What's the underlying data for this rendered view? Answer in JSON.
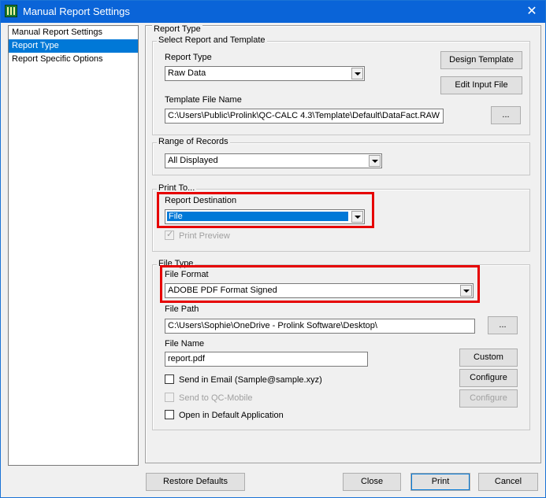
{
  "window": {
    "title": "Manual Report Settings"
  },
  "nav": {
    "items": [
      "Manual Report Settings",
      "Report Type",
      "Report Specific Options"
    ]
  },
  "report_type": {
    "group_label": "Report Type",
    "select_group_label": "Select Report and Template",
    "type_label": "Report Type",
    "type_value": "Raw Data",
    "design_template_button": "Design Template",
    "edit_input_file_button": "Edit Input File",
    "template_file_label": "Template File Name",
    "template_file_value": "C:\\Users\\Public\\Prolink\\QC-CALC 4.3\\Template\\Default\\DataFact.RAW",
    "browse_button": "..."
  },
  "range": {
    "group_label": "Range of Records",
    "value": "All Displayed"
  },
  "print_to": {
    "group_label": "Print To...",
    "destination_label": "Report Destination",
    "destination_value": "File",
    "print_preview_label": "Print Preview"
  },
  "file_type": {
    "group_label": "File Type",
    "format_label": "File Format",
    "format_value": "ADOBE PDF Format Signed",
    "path_label": "File Path",
    "path_value": "C:\\Users\\Sophie\\OneDrive - Prolink Software\\Desktop\\",
    "path_browse_button": "...",
    "name_label": "File Name",
    "name_value": "report.pdf",
    "custom_button": "Custom",
    "send_email_label": "Send in Email (Sample@sample.xyz)",
    "configure_button": "Configure",
    "send_mobile_label": "Send to QC-Mobile",
    "configure_mobile_button": "Configure",
    "open_default_label": "Open in Default Application"
  },
  "footer": {
    "restore_defaults": "Restore Defaults",
    "close": "Close",
    "print": "Print",
    "cancel": "Cancel"
  },
  "colors": {
    "title_bar": "#0a64d8",
    "selection": "#0078d7",
    "highlight_box": "#e60000"
  }
}
